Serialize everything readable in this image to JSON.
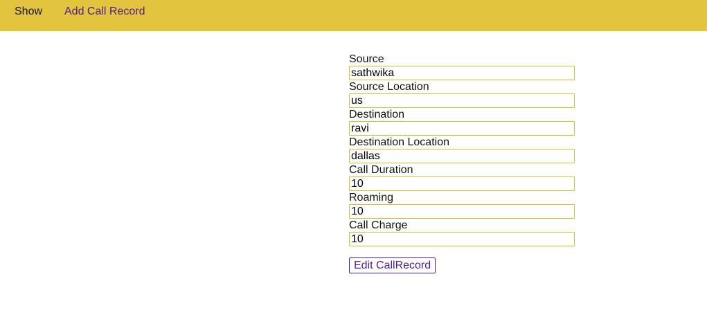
{
  "nav": {
    "show_label": "Show",
    "add_label": "Add Call Record"
  },
  "form": {
    "fields": [
      {
        "label": "Source",
        "value": "sathwika"
      },
      {
        "label": "Source Location",
        "value": "us"
      },
      {
        "label": "Destination",
        "value": "ravi"
      },
      {
        "label": "Destination Location",
        "value": "dallas"
      },
      {
        "label": "Call Duration",
        "value": "10"
      },
      {
        "label": "Roaming",
        "value": "10"
      },
      {
        "label": "Call Charge",
        "value": "10"
      }
    ],
    "submit_label": "Edit CallRecord"
  },
  "colors": {
    "navbar": "#e3c43f",
    "link": "#4b1e8e",
    "input_border": "#d8bd3a"
  }
}
